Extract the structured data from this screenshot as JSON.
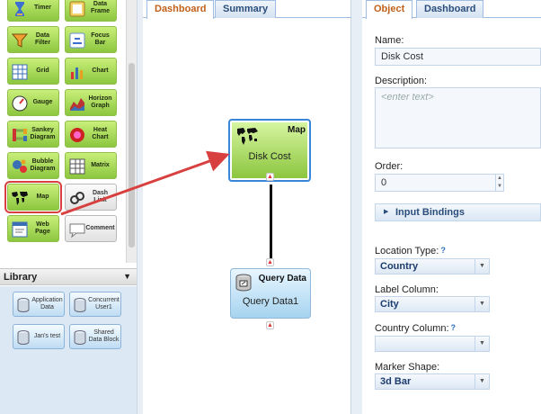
{
  "palette": {
    "tools": [
      {
        "label": "Timer",
        "icon": "hourglass-icon",
        "style": "green"
      },
      {
        "label": "Data Frame",
        "icon": "data-frame-icon",
        "style": "green"
      },
      {
        "label": "Data Filter",
        "icon": "funnel-icon",
        "style": "green"
      },
      {
        "label": "Focus Bar",
        "icon": "focus-bar-icon",
        "style": "green"
      },
      {
        "label": "Grid",
        "icon": "grid-icon",
        "style": "green"
      },
      {
        "label": "Chart",
        "icon": "bar-chart-icon",
        "style": "green"
      },
      {
        "label": "Gauge",
        "icon": "gauge-icon",
        "style": "green"
      },
      {
        "label": "Horizon Graph",
        "icon": "horizon-graph-icon",
        "style": "green"
      },
      {
        "label": "Sankey Diagram",
        "icon": "sankey-icon",
        "style": "green"
      },
      {
        "label": "Heat Chart",
        "icon": "heat-chart-icon",
        "style": "green"
      },
      {
        "label": "Bubble Diagram",
        "icon": "bubble-icon",
        "style": "green"
      },
      {
        "label": "Matrix",
        "icon": "matrix-icon",
        "style": "green"
      },
      {
        "label": "Map",
        "icon": "world-map-icon",
        "style": "green",
        "selected": true
      },
      {
        "label": "Dash Link",
        "icon": "chain-link-icon",
        "style": "gray"
      },
      {
        "label": "Web Page",
        "icon": "web-page-icon",
        "style": "green"
      },
      {
        "label": "Comment",
        "icon": "comment-icon",
        "style": "gray"
      }
    ]
  },
  "library": {
    "title": "Library",
    "items": [
      {
        "label": "Application Data",
        "icon": "database-icon"
      },
      {
        "label": "Concurrent User1",
        "icon": "database-icon"
      },
      {
        "label": "Jan's test",
        "icon": "database-icon"
      },
      {
        "label": "Shared Data Block",
        "icon": "database-icon"
      }
    ]
  },
  "canvas": {
    "tabs": [
      {
        "label": "Dashboard",
        "active": true
      },
      {
        "label": "Summary",
        "active": false
      }
    ],
    "map_node": {
      "title": "Map",
      "name": "Disk Cost",
      "icon": "world-map-icon"
    },
    "query_node": {
      "title": "Query Data",
      "name": "Query Data1",
      "icon": "database-icon"
    }
  },
  "properties": {
    "tabs": [
      {
        "label": "Object",
        "active": true
      },
      {
        "label": "Dashboard",
        "active": false
      }
    ],
    "name_label": "Name:",
    "name_value": "Disk Cost",
    "description_label": "Description:",
    "description_placeholder": "<enter text>",
    "order_label": "Order:",
    "order_value": "0",
    "input_bindings_label": "Input Bindings",
    "location_type_label": "Location Type:",
    "location_type_value": "Country",
    "label_column_label": "Label Column:",
    "label_column_value": "City",
    "country_column_label": "Country Column:",
    "country_column_value": "",
    "marker_shape_label": "Marker Shape:",
    "marker_shape_value": "3d Bar",
    "help_mark": "?"
  },
  "colors": {
    "accent": "#3a86d6",
    "active_tab_text": "#c0601a",
    "annotation_red": "#d84040",
    "tool_green": "#8cc63f",
    "library_bg": "#dce9f5"
  }
}
